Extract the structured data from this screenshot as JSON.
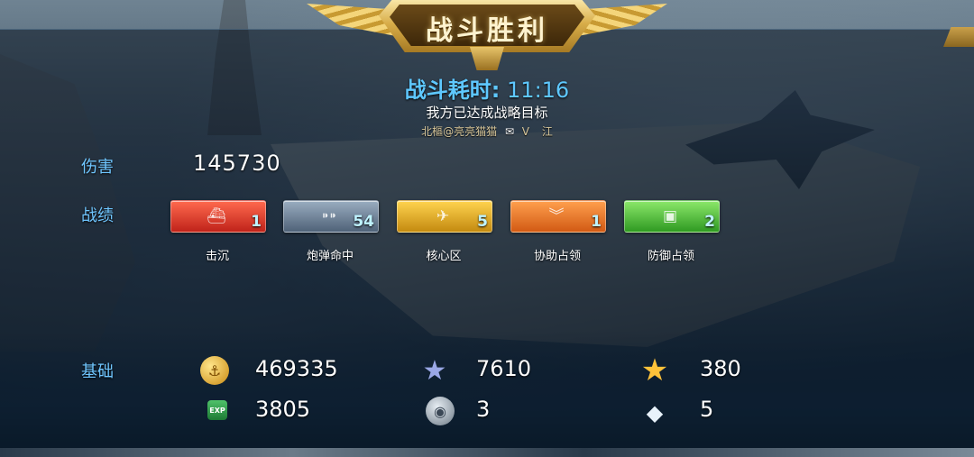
{
  "banner": {
    "title": "战斗胜利"
  },
  "battle": {
    "duration_label": "战斗耗时:",
    "duration_value": "11:16",
    "objective": "我方已达成战略目标",
    "player_name": "北樞@亮亮猫猫",
    "player_rank": "V",
    "player_server": "江"
  },
  "damage": {
    "label": "伤害",
    "value": "145730"
  },
  "record": {
    "label": "战绩",
    "badges": [
      {
        "caption": "击沉",
        "count": "1",
        "color": "#d8392a",
        "icon": "carrier-icon"
      },
      {
        "caption": "炮弹命中",
        "count": "54",
        "color": "#6a7d92",
        "icon": "shell-icon"
      },
      {
        "caption": "核心区",
        "count": "5",
        "color": "#d9a21c",
        "icon": "core-zone-icon"
      },
      {
        "caption": "协助占领",
        "count": "1",
        "color": "#e8762a",
        "icon": "assist-capture-icon"
      },
      {
        "caption": "防御占领",
        "count": "2",
        "color": "#45b82f",
        "icon": "defend-capture-icon"
      }
    ]
  },
  "basic": {
    "label": "基础",
    "gold": "469335",
    "exp": "3805",
    "merit": "7610",
    "silver_coin": "3",
    "rank_points": "380",
    "diamonds": "5"
  }
}
